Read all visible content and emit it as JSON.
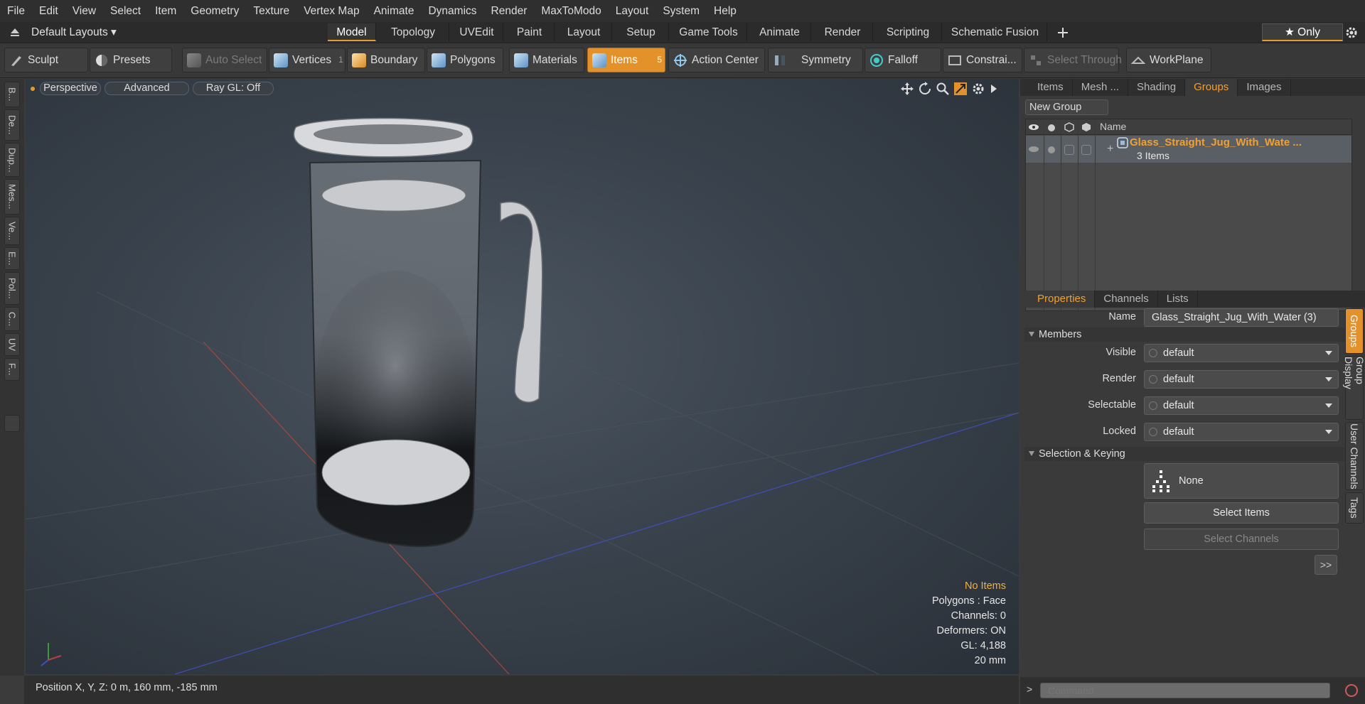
{
  "menubar": [
    "File",
    "Edit",
    "View",
    "Select",
    "Item",
    "Geometry",
    "Texture",
    "Vertex Map",
    "Animate",
    "Dynamics",
    "Render",
    "MaxToModo",
    "Layout",
    "System",
    "Help"
  ],
  "layouts": {
    "label": "Default Layouts ▾"
  },
  "layout_tabs": [
    "Model",
    "Topology",
    "UVEdit",
    "Paint",
    "Layout",
    "Setup",
    "Game Tools",
    "Animate",
    "Render",
    "Scripting",
    "Schematic Fusion"
  ],
  "only_label": "★  Only",
  "toolbar": {
    "sculpt": "Sculpt",
    "presets": "Presets",
    "auto_select": "Auto Select",
    "vertices": "Vertices",
    "vertices_count": "1",
    "boundary": "Boundary",
    "polygons": "Polygons",
    "materials": "Materials",
    "items": "Items",
    "items_count": "5",
    "action_center": "Action Center",
    "symmetry": "Symmetry",
    "falloff": "Falloff",
    "constraints": "Constrai...",
    "select_through": "Select Through",
    "workplane": "WorkPlane"
  },
  "left_tabs": [
    "B...",
    "De...",
    "Dup...",
    "Mes...",
    "Ve...",
    "E...",
    "Pol...",
    "C...",
    "UV",
    "F..."
  ],
  "viewport": {
    "perspective": "Perspective",
    "advanced": "Advanced",
    "raygl": "Ray GL: Off",
    "stats": {
      "no_items": "No Items",
      "polygons": "Polygons : Face",
      "channels": "Channels: 0",
      "deformers": "Deformers: ON",
      "gl": "GL: 4,188",
      "grid": "20 mm"
    }
  },
  "statusbar": {
    "position": "Position X, Y, Z:   0 m, 160 mm, -185 mm"
  },
  "top_panel": {
    "tabs": [
      "Items",
      "Mesh ...",
      "Shading",
      "Groups",
      "Images"
    ],
    "new_group": "New Group",
    "name_header": "Name",
    "group": {
      "name": "Glass_Straight_Jug_With_Wate ...",
      "items": "3 Items"
    }
  },
  "bottom_panel": {
    "tabs": [
      "Properties",
      "Channels",
      "Lists"
    ],
    "name_label": "Name",
    "name_value": "Glass_Straight_Jug_With_Water (3)",
    "members_section": "Members",
    "rows": [
      {
        "label": "Visible",
        "value": "default"
      },
      {
        "label": "Render",
        "value": "default"
      },
      {
        "label": "Selectable",
        "value": "default"
      },
      {
        "label": "Locked",
        "value": "default"
      }
    ],
    "sel_section": "Selection & Keying",
    "none": "None",
    "select_items": "Select Items",
    "select_channels": "Select Channels",
    "more": ">>",
    "side_tabs": [
      "Groups",
      "Group Display",
      "User Channels",
      "Tags"
    ]
  },
  "command": {
    "placeholder": "Command"
  }
}
